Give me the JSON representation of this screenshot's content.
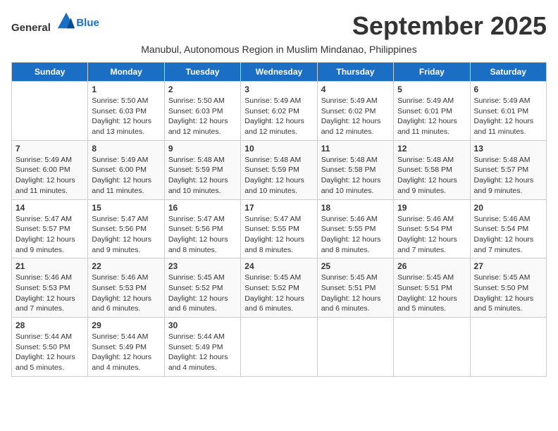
{
  "header": {
    "logo_general": "General",
    "logo_blue": "Blue",
    "month_title": "September 2025",
    "subtitle": "Manubul, Autonomous Region in Muslim Mindanao, Philippines"
  },
  "days_of_week": [
    "Sunday",
    "Monday",
    "Tuesday",
    "Wednesday",
    "Thursday",
    "Friday",
    "Saturday"
  ],
  "weeks": [
    [
      {
        "day": "",
        "info": ""
      },
      {
        "day": "1",
        "info": "Sunrise: 5:50 AM\nSunset: 6:03 PM\nDaylight: 12 hours\nand 13 minutes."
      },
      {
        "day": "2",
        "info": "Sunrise: 5:50 AM\nSunset: 6:03 PM\nDaylight: 12 hours\nand 12 minutes."
      },
      {
        "day": "3",
        "info": "Sunrise: 5:49 AM\nSunset: 6:02 PM\nDaylight: 12 hours\nand 12 minutes."
      },
      {
        "day": "4",
        "info": "Sunrise: 5:49 AM\nSunset: 6:02 PM\nDaylight: 12 hours\nand 12 minutes."
      },
      {
        "day": "5",
        "info": "Sunrise: 5:49 AM\nSunset: 6:01 PM\nDaylight: 12 hours\nand 11 minutes."
      },
      {
        "day": "6",
        "info": "Sunrise: 5:49 AM\nSunset: 6:01 PM\nDaylight: 12 hours\nand 11 minutes."
      }
    ],
    [
      {
        "day": "7",
        "info": "Sunrise: 5:49 AM\nSunset: 6:00 PM\nDaylight: 12 hours\nand 11 minutes."
      },
      {
        "day": "8",
        "info": "Sunrise: 5:49 AM\nSunset: 6:00 PM\nDaylight: 12 hours\nand 11 minutes."
      },
      {
        "day": "9",
        "info": "Sunrise: 5:48 AM\nSunset: 5:59 PM\nDaylight: 12 hours\nand 10 minutes."
      },
      {
        "day": "10",
        "info": "Sunrise: 5:48 AM\nSunset: 5:59 PM\nDaylight: 12 hours\nand 10 minutes."
      },
      {
        "day": "11",
        "info": "Sunrise: 5:48 AM\nSunset: 5:58 PM\nDaylight: 12 hours\nand 10 minutes."
      },
      {
        "day": "12",
        "info": "Sunrise: 5:48 AM\nSunset: 5:58 PM\nDaylight: 12 hours\nand 9 minutes."
      },
      {
        "day": "13",
        "info": "Sunrise: 5:48 AM\nSunset: 5:57 PM\nDaylight: 12 hours\nand 9 minutes."
      }
    ],
    [
      {
        "day": "14",
        "info": "Sunrise: 5:47 AM\nSunset: 5:57 PM\nDaylight: 12 hours\nand 9 minutes."
      },
      {
        "day": "15",
        "info": "Sunrise: 5:47 AM\nSunset: 5:56 PM\nDaylight: 12 hours\nand 9 minutes."
      },
      {
        "day": "16",
        "info": "Sunrise: 5:47 AM\nSunset: 5:56 PM\nDaylight: 12 hours\nand 8 minutes."
      },
      {
        "day": "17",
        "info": "Sunrise: 5:47 AM\nSunset: 5:55 PM\nDaylight: 12 hours\nand 8 minutes."
      },
      {
        "day": "18",
        "info": "Sunrise: 5:46 AM\nSunset: 5:55 PM\nDaylight: 12 hours\nand 8 minutes."
      },
      {
        "day": "19",
        "info": "Sunrise: 5:46 AM\nSunset: 5:54 PM\nDaylight: 12 hours\nand 7 minutes."
      },
      {
        "day": "20",
        "info": "Sunrise: 5:46 AM\nSunset: 5:54 PM\nDaylight: 12 hours\nand 7 minutes."
      }
    ],
    [
      {
        "day": "21",
        "info": "Sunrise: 5:46 AM\nSunset: 5:53 PM\nDaylight: 12 hours\nand 7 minutes."
      },
      {
        "day": "22",
        "info": "Sunrise: 5:46 AM\nSunset: 5:53 PM\nDaylight: 12 hours\nand 6 minutes."
      },
      {
        "day": "23",
        "info": "Sunrise: 5:45 AM\nSunset: 5:52 PM\nDaylight: 12 hours\nand 6 minutes."
      },
      {
        "day": "24",
        "info": "Sunrise: 5:45 AM\nSunset: 5:52 PM\nDaylight: 12 hours\nand 6 minutes."
      },
      {
        "day": "25",
        "info": "Sunrise: 5:45 AM\nSunset: 5:51 PM\nDaylight: 12 hours\nand 6 minutes."
      },
      {
        "day": "26",
        "info": "Sunrise: 5:45 AM\nSunset: 5:51 PM\nDaylight: 12 hours\nand 5 minutes."
      },
      {
        "day": "27",
        "info": "Sunrise: 5:45 AM\nSunset: 5:50 PM\nDaylight: 12 hours\nand 5 minutes."
      }
    ],
    [
      {
        "day": "28",
        "info": "Sunrise: 5:44 AM\nSunset: 5:50 PM\nDaylight: 12 hours\nand 5 minutes."
      },
      {
        "day": "29",
        "info": "Sunrise: 5:44 AM\nSunset: 5:49 PM\nDaylight: 12 hours\nand 4 minutes."
      },
      {
        "day": "30",
        "info": "Sunrise: 5:44 AM\nSunset: 5:49 PM\nDaylight: 12 hours\nand 4 minutes."
      },
      {
        "day": "",
        "info": ""
      },
      {
        "day": "",
        "info": ""
      },
      {
        "day": "",
        "info": ""
      },
      {
        "day": "",
        "info": ""
      }
    ]
  ]
}
